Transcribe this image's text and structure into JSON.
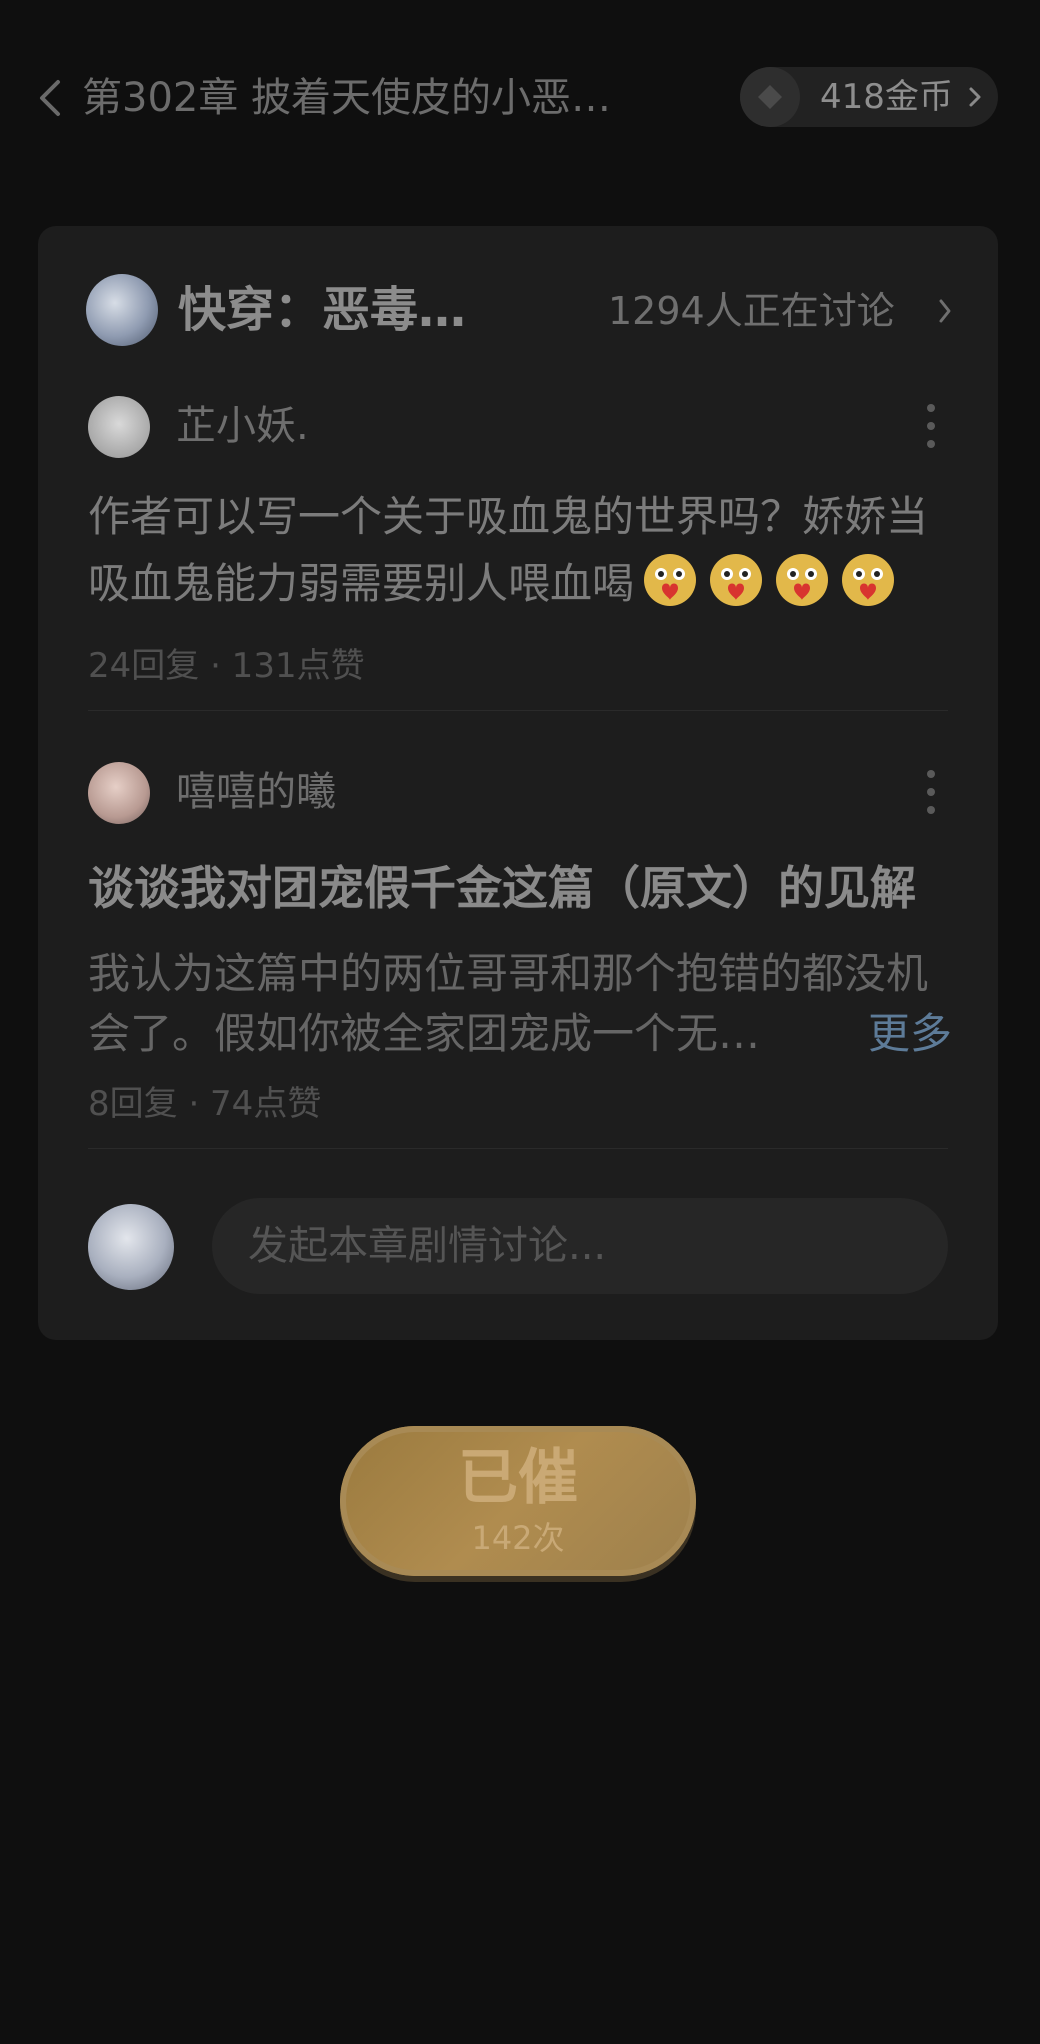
{
  "header": {
    "chapter_title": "第302章 披着天使皮的小恶…",
    "coins": "418金币"
  },
  "discussion": {
    "book_title": "快穿：恶毒…",
    "discuss_count": "1294人正在讨论",
    "comments": [
      {
        "user": "芷小妖.",
        "text": "作者可以写一个关于吸血鬼的世界吗？娇娇当吸血鬼能力弱需要别人喂血喝",
        "emoji_count": 4,
        "stats": "24回复 · 131点赞"
      },
      {
        "user": "嘻嘻的曦",
        "title": "谈谈我对团宠假千金这篇（原文）的见解",
        "text": "我认为这篇中的两位哥哥和那个抱错的都没机会了。假如你被全家团宠成一个无…",
        "more": "更多",
        "stats": "8回复 · 74点赞"
      }
    ],
    "compose_placeholder": "发起本章剧情讨论..."
  },
  "urge": {
    "label": "已催",
    "count": "142次"
  },
  "icons": {
    "back": "chevron-left-icon",
    "coin": "coin-icon",
    "more": "more-vertical-icon",
    "emoji": "heart-hug-emoji-icon"
  },
  "colors": {
    "background": "#0f0f0f",
    "card": "#1d1d1d",
    "accent_gold": "#b08c4f",
    "link": "#5d7b98"
  }
}
